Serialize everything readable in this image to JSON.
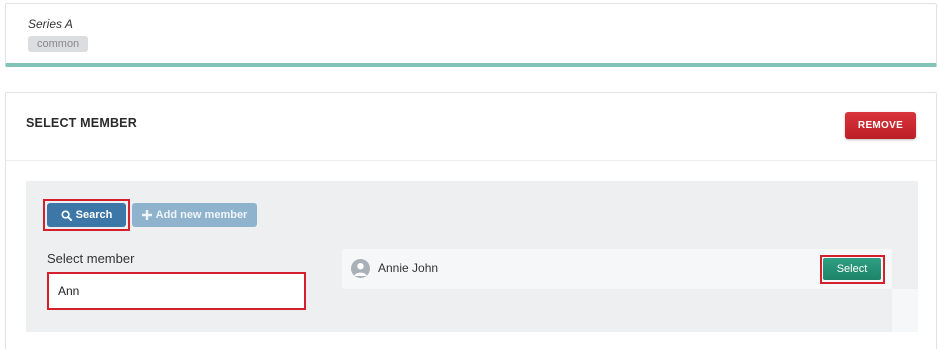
{
  "series": {
    "title": "Series A",
    "tag": "common"
  },
  "member_panel": {
    "title": "SELECT MEMBER",
    "remove_label": "REMOVE",
    "search_label": "Search",
    "add_new_label": "Add new member",
    "select_member_label": "Select member",
    "member_input_value": "Ann",
    "results": [
      {
        "name": "Annie John",
        "select_label": "Select"
      }
    ]
  },
  "colors": {
    "accent_teal": "#82c3b7",
    "remove_red": "#c8262d",
    "search_blue": "#3d77a8",
    "select_green": "#268f75",
    "highlight_red": "#d3202a"
  },
  "icons": {
    "search": "search-icon",
    "add": "plus-icon",
    "avatar": "user-avatar-icon"
  }
}
